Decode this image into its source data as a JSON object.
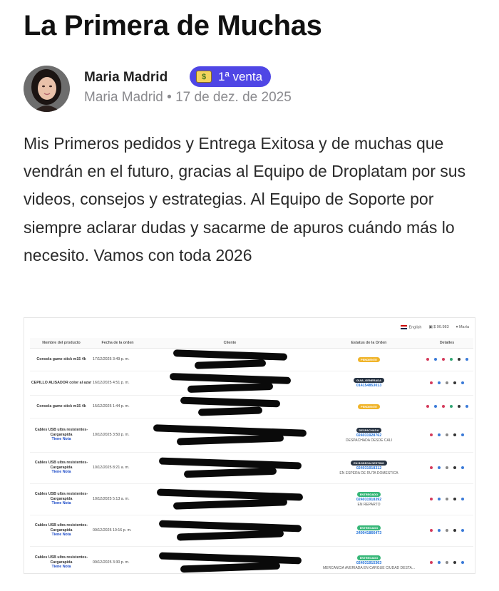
{
  "post": {
    "title": "La Primera de Muchas",
    "author": "Maria Madrid",
    "badge": {
      "icon": "money-icon",
      "label": "1ª venta",
      "color": "#4f46e5"
    },
    "meta_author": "Maria Madrid",
    "meta_separator": "•",
    "date": "17 de dez. de 2025",
    "body": "Mis Primeros pedidos y Entrega Exitosa y de muchas que vendrán en el futuro, gracias al Equipo de Droplatam por sus videos, consejos y estrategias. Al Equipo de Soporte por siempre aclarar dudas y sacarme de apuros cuándo más lo necesito. Vamos con toda 2026"
  },
  "screenshot": {
    "topbar": {
      "language": "English",
      "balance": "$ 90.983",
      "user": "María"
    },
    "columns": [
      "Nombre del producto",
      "Fecha de la orden",
      "Cliente",
      "Estatus de la Orden",
      "Detalles"
    ],
    "rows": [
      {
        "product": "Consola game stick m15 4k",
        "date": "17/12/2025 3:49 p. m.",
        "status": "PENDIENTE",
        "guide": "",
        "note": ""
      },
      {
        "product": "CEPILLO ALISADOR color al azar",
        "date": "16/12/2025 4:51 p. m.",
        "status": "GUIA_GENERADA",
        "guide": "014154853013",
        "note": ""
      },
      {
        "product": "Consola game stick m15 4k",
        "date": "15/12/2025 1:44 p. m.",
        "status": "PENDIENTE",
        "guide": "",
        "note": ""
      },
      {
        "product": "Cables USB ultra resistentes-Cargarapida",
        "tiene_nota": "Tiene Nota",
        "date": "10/12/2025 3:50 p. m.",
        "status": "DESPACHADA",
        "guide": "024031928762",
        "note": "DESPACHADA DESDE CALI"
      },
      {
        "product": "Cables USB ultra resistentes-Cargarapida",
        "tiene_nota": "Tiene Nota",
        "date": "10/12/2025 8:21 a. m.",
        "status": "EN BODEGA DESTINO",
        "guide": "024031918312",
        "note": "EN ESPERA DE RUTA DOMESTICA"
      },
      {
        "product": "Cables USB ultra resistentes-Cargarapida",
        "tiene_nota": "Tiene Nota",
        "date": "10/12/2025 5:13 a. m.",
        "status": "ENTREGADO",
        "guide": "024031918392",
        "note": "EN REPARTO"
      },
      {
        "product": "Cables USB ultra resistentes-Cargarapida",
        "tiene_nota": "Tiene Nota",
        "date": "09/12/2025 10:16 p. m.",
        "status": "ENTREGADO",
        "guide": "240041866473",
        "note": ""
      },
      {
        "product": "Cables USB ultra resistentes-Cargarapida",
        "tiene_nota": "Tiene Nota",
        "date": "09/12/2025 3:30 p. m.",
        "status": "ENTREGADO",
        "guide": "024031915363",
        "note": "MERCANCIA AVERIADA EN CARGUE CIUDAD DESTA..."
      }
    ]
  }
}
